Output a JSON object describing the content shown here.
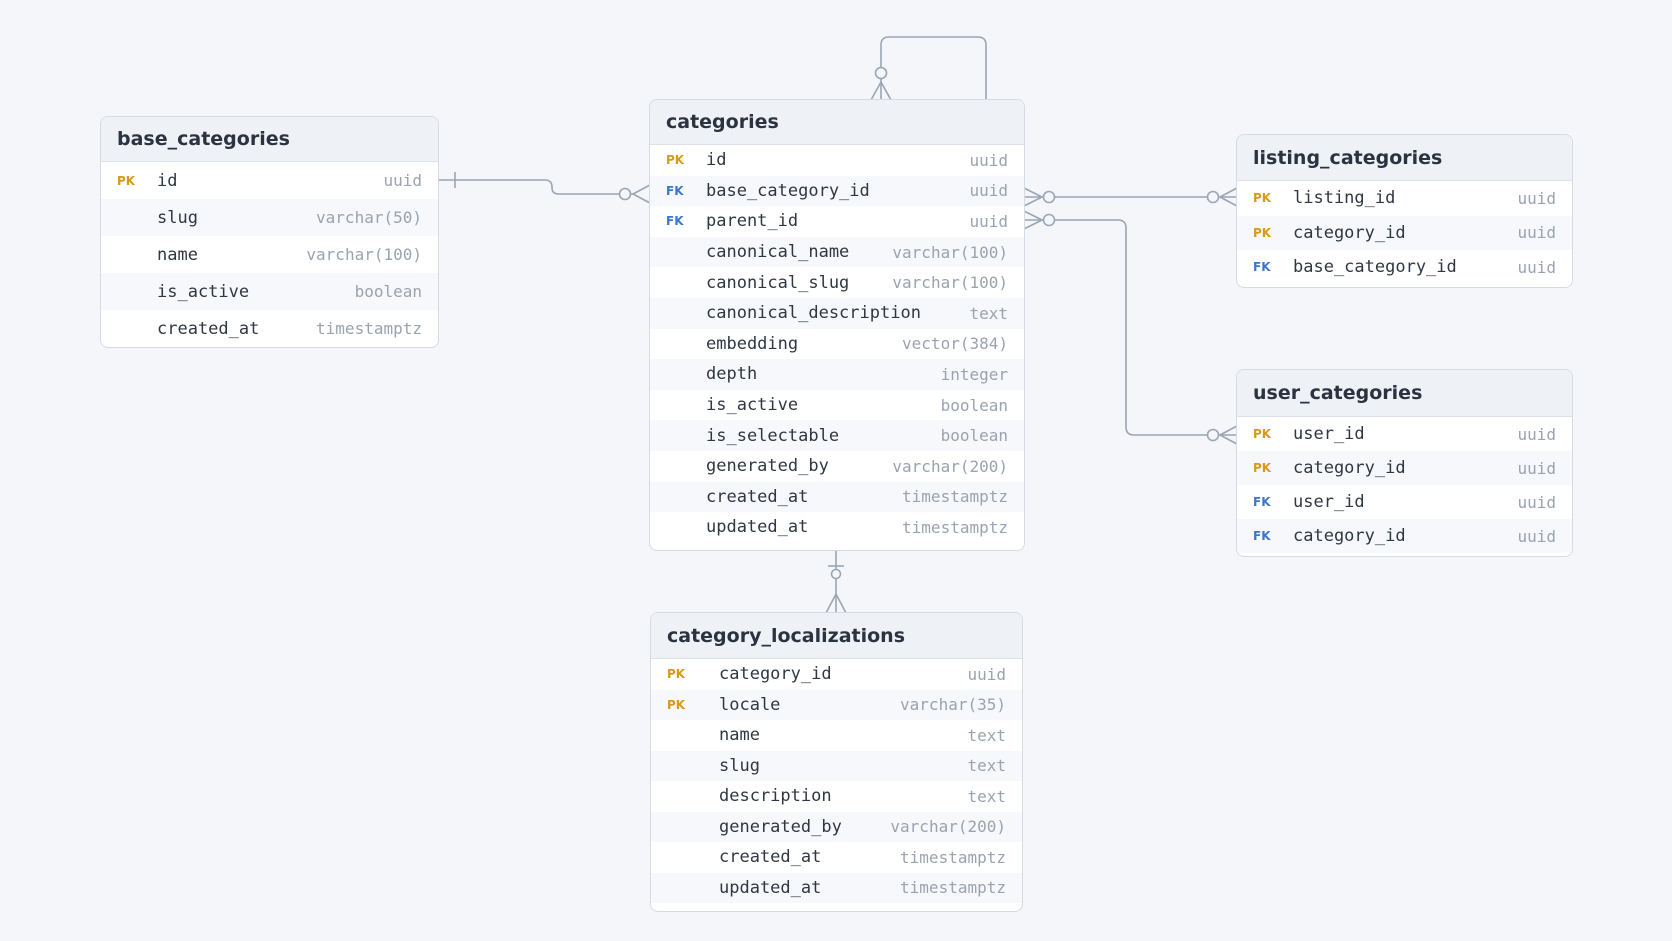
{
  "colors": {
    "background": "#f4f6fa",
    "line": "#9aa6b5",
    "pk": "#d99a1a",
    "fk": "#3a78c9"
  },
  "tables": [
    {
      "name": "base_categories",
      "columns": [
        {
          "key": "PK",
          "name": "id",
          "type": "uuid"
        },
        {
          "key": "",
          "name": "slug",
          "type": "varchar(50)"
        },
        {
          "key": "",
          "name": "name",
          "type": "varchar(100)"
        },
        {
          "key": "",
          "name": "is_active",
          "type": "boolean"
        },
        {
          "key": "",
          "name": "created_at",
          "type": "timestamptz"
        }
      ]
    },
    {
      "name": "categories",
      "columns": [
        {
          "key": "PK",
          "name": "id",
          "type": "uuid"
        },
        {
          "key": "FK",
          "name": "base_category_id",
          "type": "uuid"
        },
        {
          "key": "FK",
          "name": "parent_id",
          "type": "uuid"
        },
        {
          "key": "",
          "name": "canonical_name",
          "type": "varchar(100)"
        },
        {
          "key": "",
          "name": "canonical_slug",
          "type": "varchar(100)"
        },
        {
          "key": "",
          "name": "canonical_description",
          "type": "text"
        },
        {
          "key": "",
          "name": "embedding",
          "type": "vector(384)"
        },
        {
          "key": "",
          "name": "depth",
          "type": "integer"
        },
        {
          "key": "",
          "name": "is_active",
          "type": "boolean"
        },
        {
          "key": "",
          "name": "is_selectable",
          "type": "boolean"
        },
        {
          "key": "",
          "name": "generated_by",
          "type": "varchar(200)"
        },
        {
          "key": "",
          "name": "created_at",
          "type": "timestamptz"
        },
        {
          "key": "",
          "name": "updated_at",
          "type": "timestamptz"
        }
      ]
    },
    {
      "name": "listing_categories",
      "columns": [
        {
          "key": "PK",
          "name": "listing_id",
          "type": "uuid"
        },
        {
          "key": "PK",
          "name": "category_id",
          "type": "uuid"
        },
        {
          "key": "FK",
          "name": "base_category_id",
          "type": "uuid"
        }
      ]
    },
    {
      "name": "user_categories",
      "columns": [
        {
          "key": "PK",
          "name": "user_id",
          "type": "uuid"
        },
        {
          "key": "PK",
          "name": "category_id",
          "type": "uuid"
        },
        {
          "key": "FK",
          "name": "user_id",
          "type": "uuid"
        },
        {
          "key": "FK",
          "name": "category_id",
          "type": "uuid"
        }
      ]
    },
    {
      "name": "category_localizations",
      "columns": [
        {
          "key": "PK",
          "name": "category_id",
          "type": "uuid"
        },
        {
          "key": "PK",
          "name": "locale",
          "type": "varchar(35)"
        },
        {
          "key": "",
          "name": "name",
          "type": "text"
        },
        {
          "key": "",
          "name": "slug",
          "type": "text"
        },
        {
          "key": "",
          "name": "description",
          "type": "text"
        },
        {
          "key": "",
          "name": "generated_by",
          "type": "varchar(200)"
        },
        {
          "key": "",
          "name": "created_at",
          "type": "timestamptz"
        },
        {
          "key": "",
          "name": "updated_at",
          "type": "timestamptz"
        }
      ]
    }
  ],
  "relationships": [
    {
      "from": "base_categories",
      "to": "categories",
      "from_card": "one",
      "to_card": "zero-or-many"
    },
    {
      "from": "categories",
      "to": "categories",
      "from_card": "one",
      "to_card": "zero-or-many"
    },
    {
      "from": "categories",
      "to": "listing_categories",
      "from_card": "zero-or-many",
      "to_card": "zero-or-many"
    },
    {
      "from": "categories",
      "to": "user_categories",
      "from_card": "zero-or-many",
      "to_card": "zero-or-many"
    },
    {
      "from": "categories",
      "to": "category_localizations",
      "from_card": "one",
      "to_card": "zero-or-many"
    }
  ]
}
